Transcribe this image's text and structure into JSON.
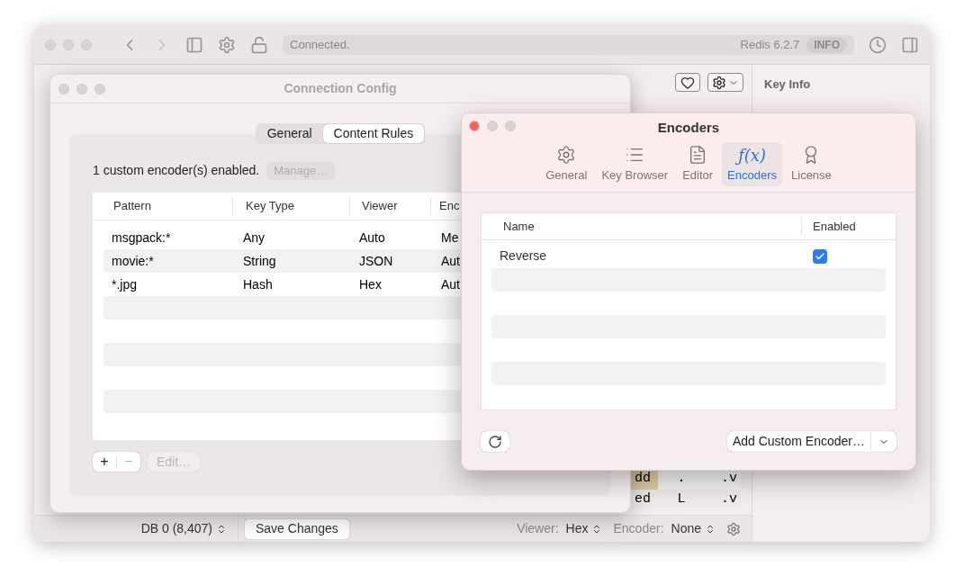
{
  "main_window": {
    "status": "Connected.",
    "server_version": "Redis 6.2.7",
    "info_badge": "INFO",
    "key_info_title": "Key Info",
    "hex_rows": [
      {
        "cells": [
          "dd",
          ".",
          ".v"
        ],
        "selected": true
      },
      {
        "cells": [
          "ed",
          "L",
          ".v"
        ],
        "selected": false
      }
    ],
    "status_bar": {
      "database": "DB 0 (8,407)",
      "save_button": "Save Changes",
      "viewer_label": "Viewer:",
      "viewer_value": "Hex",
      "encoder_label": "Encoder:",
      "encoder_value": "None"
    }
  },
  "connection_config": {
    "title": "Connection Config",
    "tabs": [
      {
        "label": "General",
        "selected": false
      },
      {
        "label": "Content Rules",
        "selected": true
      }
    ],
    "encoders_note": "1 custom encoder(s) enabled.",
    "manage_button": {
      "label": "Manage…",
      "disabled": true
    },
    "table": {
      "columns": [
        "Pattern",
        "Key Type",
        "Viewer",
        "Enc"
      ],
      "rows": [
        {
          "cells": [
            "msgpack:*",
            "Any",
            "Auto",
            "Me"
          ]
        },
        {
          "cells": [
            "movie:*",
            "String",
            "JSON",
            "Aut"
          ]
        },
        {
          "cells": [
            "*.jpg",
            "Hash",
            "Hex",
            "Aut"
          ]
        }
      ]
    },
    "add_button": {
      "label": "+",
      "disabled": false
    },
    "remove_button": {
      "label": "−",
      "disabled": true
    },
    "edit_button": {
      "label": "Edit…",
      "disabled": true
    }
  },
  "encoders_window": {
    "title": "Encoders",
    "tabs": [
      {
        "label": "General",
        "selected": false
      },
      {
        "label": "Key Browser",
        "selected": false
      },
      {
        "label": "Editor",
        "selected": false
      },
      {
        "label": "Encoders",
        "selected": true,
        "glyph": "ƒ(x)"
      },
      {
        "label": "License",
        "selected": false
      }
    ],
    "table": {
      "columns": [
        "Name",
        "Enabled"
      ],
      "rows": [
        {
          "name": "Reverse",
          "checked": true
        }
      ]
    },
    "add_button": "Add Custom Encoder…"
  }
}
